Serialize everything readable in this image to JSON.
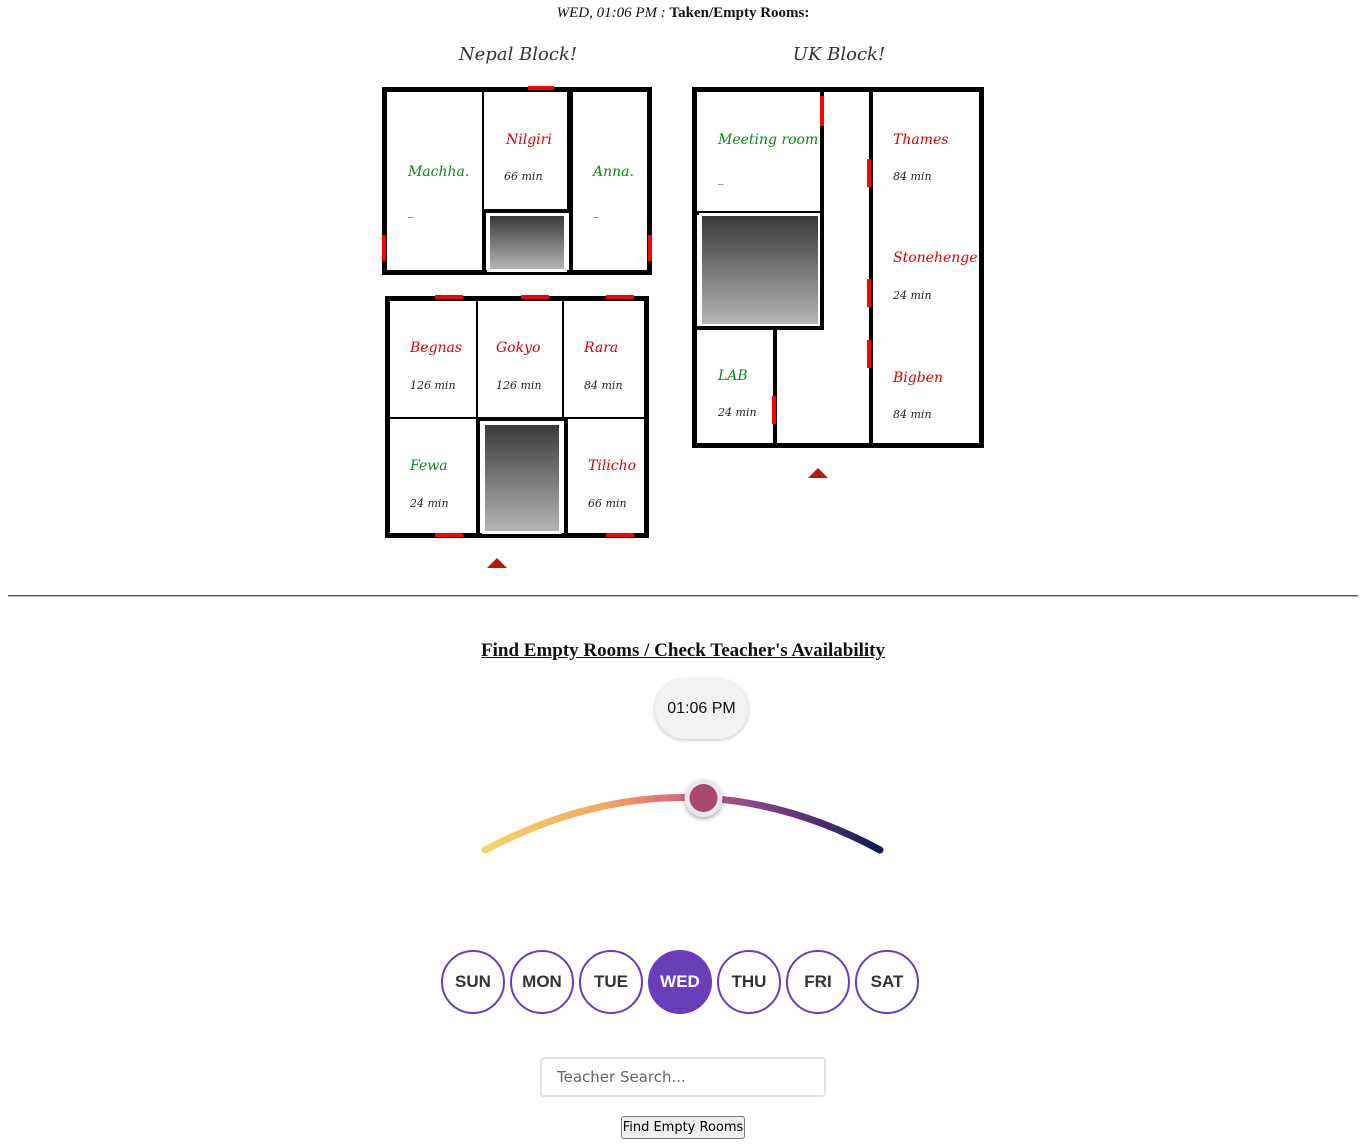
{
  "status": {
    "time": "WED, 01:06 PM :",
    "label": "Taken/Empty Rooms:"
  },
  "nepal_block": {
    "title": "Nepal Block!",
    "rooms": {
      "machha": {
        "name": "Machha.",
        "meta": "_",
        "state": "empty"
      },
      "nilgiri": {
        "name": "Nilgiri",
        "meta": "66 min",
        "state": "taken"
      },
      "anna": {
        "name": "Anna.",
        "meta": "_",
        "state": "empty"
      },
      "begnas": {
        "name": "Begnas",
        "meta": "126 min",
        "state": "taken"
      },
      "gokyo": {
        "name": "Gokyo",
        "meta": "126 min",
        "state": "taken"
      },
      "rara": {
        "name": "Rara",
        "meta": "84 min",
        "state": "taken"
      },
      "fewa": {
        "name": "Fewa",
        "meta": "24 min",
        "state": "empty"
      },
      "tilicho": {
        "name": "Tilicho",
        "meta": "66 min",
        "state": "taken"
      }
    }
  },
  "uk_block": {
    "title": "UK Block!",
    "rooms": {
      "meeting": {
        "name": "Meeting room",
        "meta": "_",
        "state": "empty"
      },
      "thames": {
        "name": "Thames",
        "meta": "84 min",
        "state": "taken"
      },
      "stonehenge": {
        "name": "Stonehenge",
        "meta": "24 min",
        "state": "taken"
      },
      "lab": {
        "name": "LAB",
        "meta": "24 min",
        "state": "empty"
      },
      "bigben": {
        "name": "Bigben",
        "meta": "84 min",
        "state": "taken"
      }
    }
  },
  "finder": {
    "title": "Find Empty Rooms / Check Teacher's Availability",
    "time_value": "01:06 PM",
    "slider_fraction": 0.55,
    "days": [
      "SUN",
      "MON",
      "TUE",
      "WED",
      "THU",
      "FRI",
      "SAT"
    ],
    "active_day": "WED",
    "search_placeholder": "Teacher Search...",
    "button_label": "Find Empty Rooms"
  },
  "colors": {
    "taken": "#e00000",
    "empty": "#0a8a12",
    "accent": "#6a3dbb",
    "door": "#ff0000"
  }
}
